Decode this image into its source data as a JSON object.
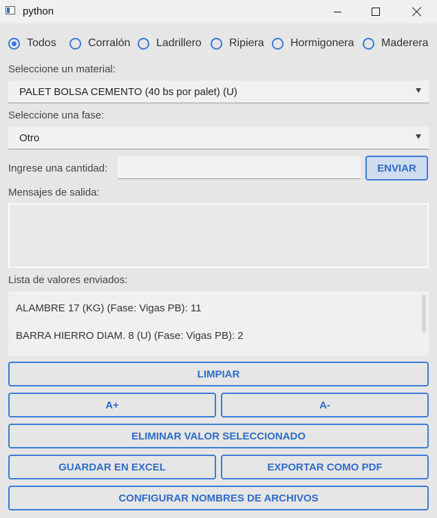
{
  "window": {
    "title": "python"
  },
  "radios": [
    {
      "label": "Todos",
      "checked": true
    },
    {
      "label": "Corralón",
      "checked": false
    },
    {
      "label": "Ladrillero",
      "checked": false
    },
    {
      "label": "Ripiera",
      "checked": false
    },
    {
      "label": "Hormigonera",
      "checked": false
    },
    {
      "label": "Maderera",
      "checked": false
    }
  ],
  "material": {
    "label": "Seleccione un material:",
    "selected": "PALET BOLSA CEMENTO (40 bs por palet) (U)"
  },
  "fase": {
    "label": "Seleccione una fase:",
    "selected": "Otro"
  },
  "cantidad": {
    "label": "Ingrese una cantidad:",
    "value": "",
    "send_label": "ENVIAR"
  },
  "mensajes": {
    "label": "Mensajes de salida:",
    "text": ""
  },
  "lista": {
    "label": "Lista de valores enviados:",
    "items": [
      "ALAMBRE 17 (KG) (Fase: Vigas PB): 11",
      "BARRA HIERRO DIAM. 8 (U) (Fase: Vigas PB): 2"
    ]
  },
  "buttons": {
    "limpiar": "LIMPIAR",
    "font_plus": "A+",
    "font_minus": "A-",
    "eliminar": "ELIMINAR VALOR SELECCIONADO",
    "excel": "GUARDAR EN EXCEL",
    "pdf": "EXPORTAR COMO PDF",
    "config": "CONFIGURAR NOMBRES DE ARCHIVOS"
  },
  "colors": {
    "accent": "#3a7bd5",
    "background": "#e6e6e6"
  }
}
